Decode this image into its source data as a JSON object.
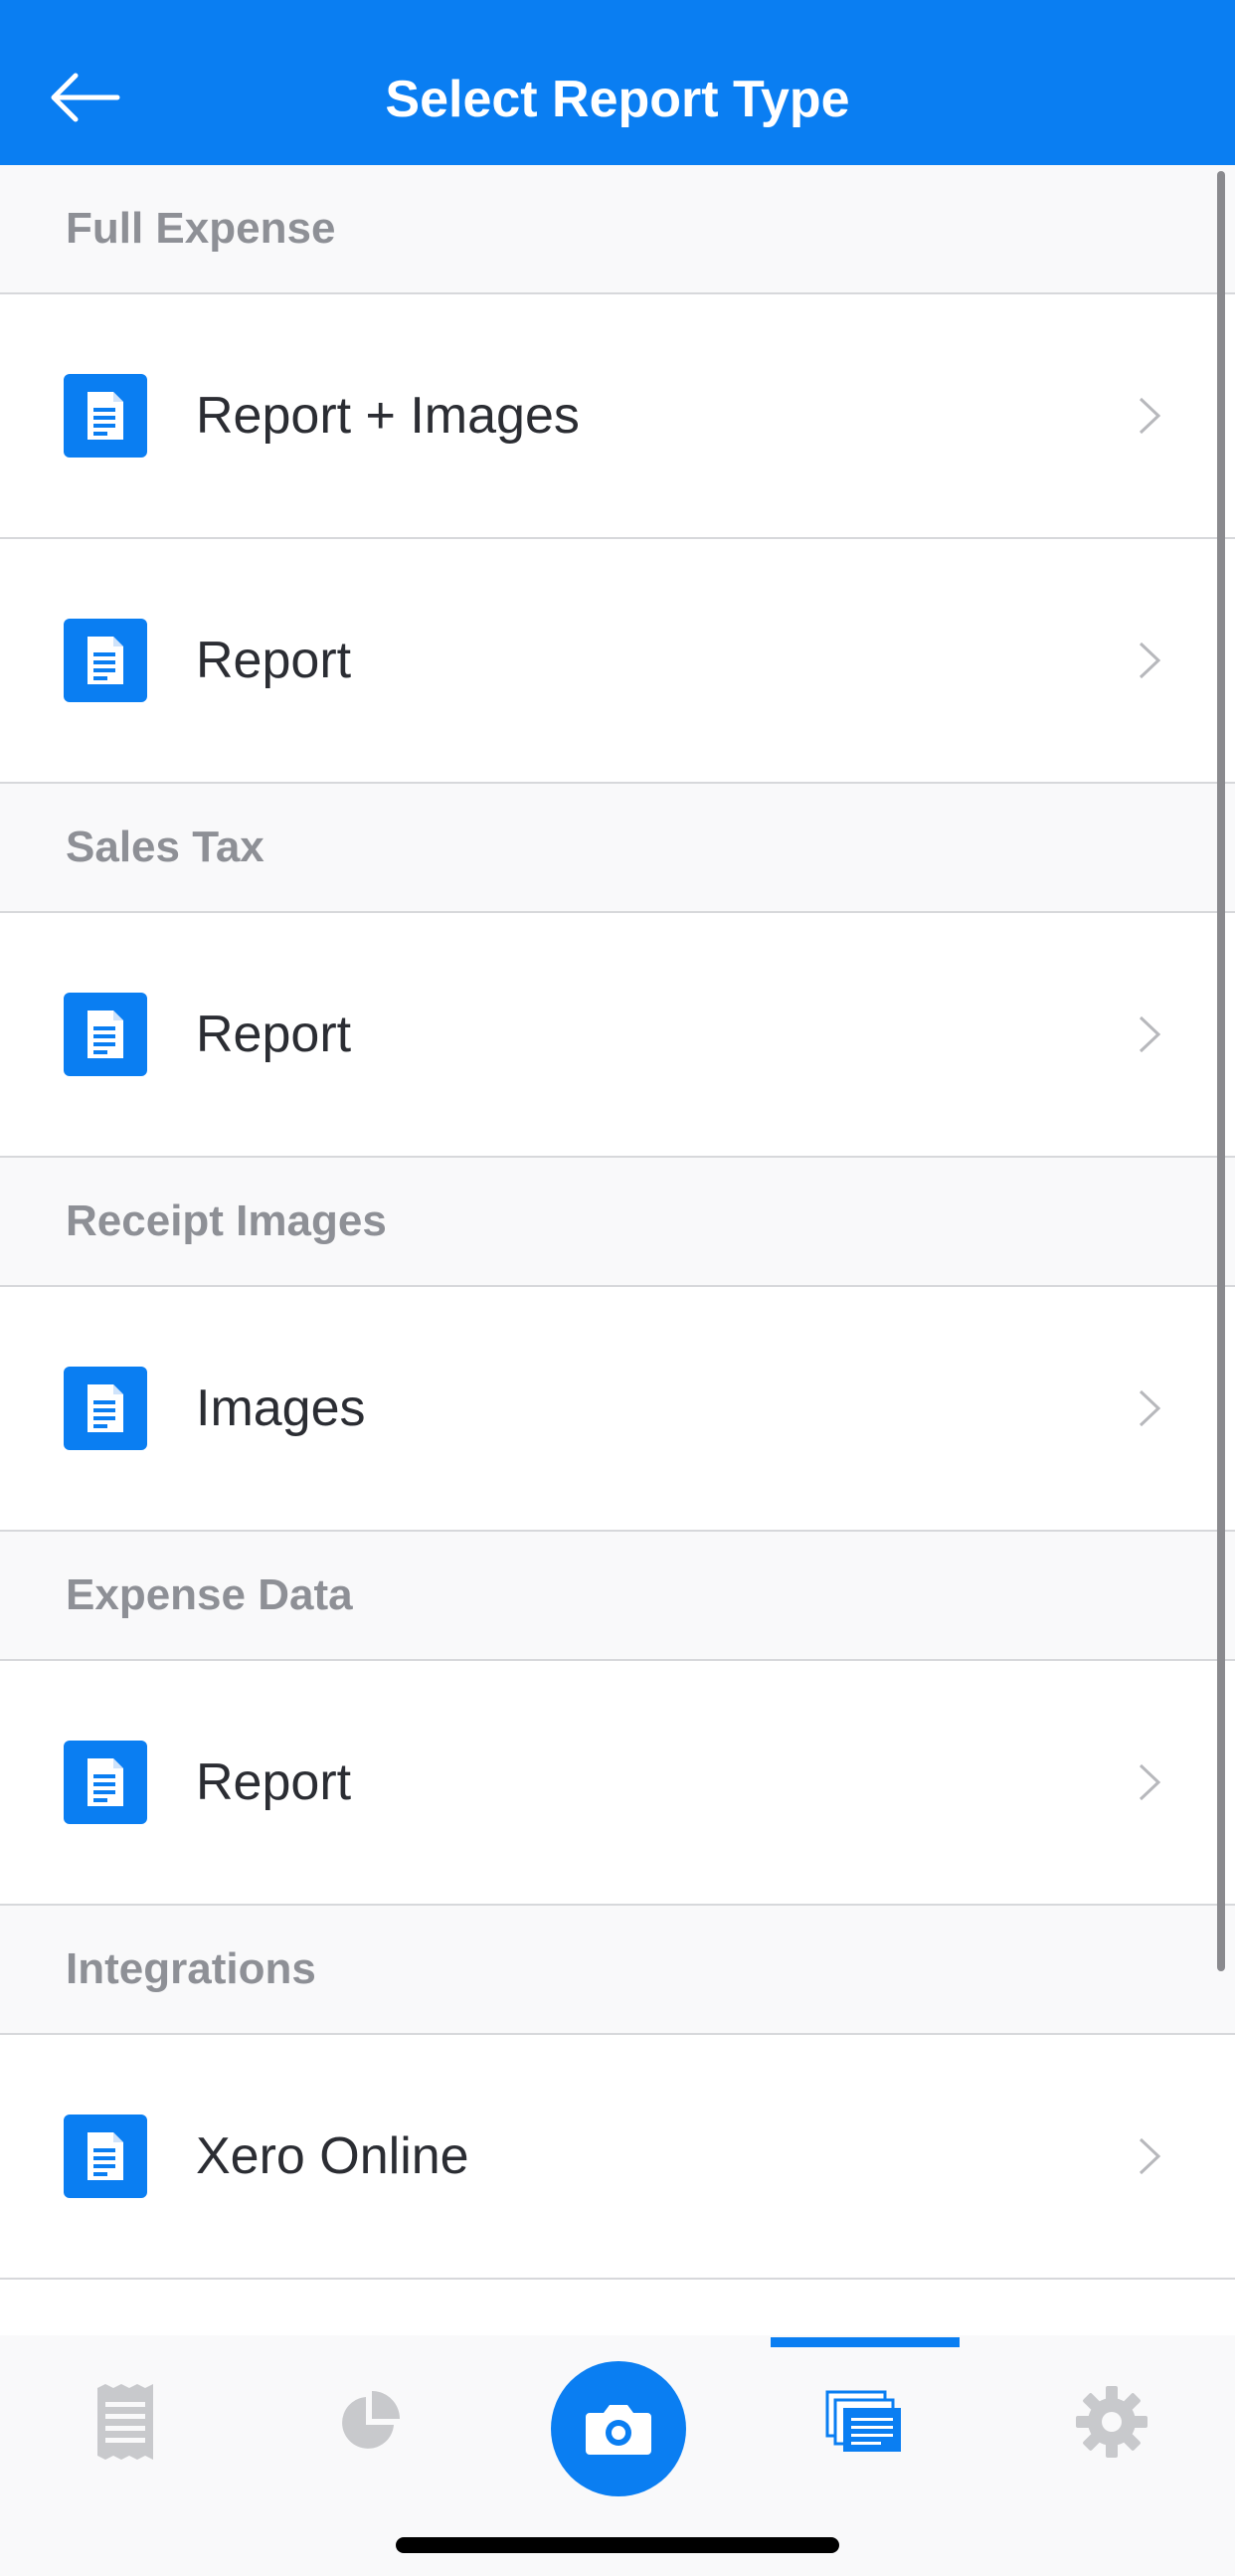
{
  "header": {
    "title": "Select Report Type",
    "back_icon": "arrow-left-icon",
    "color": "#0a7ef2"
  },
  "sections": [
    {
      "title": "Full Expense",
      "items": [
        {
          "label": "Report + Images",
          "icon": "document-icon"
        },
        {
          "label": "Report",
          "icon": "document-icon"
        }
      ]
    },
    {
      "title": "Sales Tax",
      "items": [
        {
          "label": "Report",
          "icon": "document-icon"
        }
      ]
    },
    {
      "title": "Receipt Images",
      "items": [
        {
          "label": "Images",
          "icon": "document-icon"
        }
      ]
    },
    {
      "title": "Expense Data",
      "items": [
        {
          "label": "Report",
          "icon": "document-icon"
        }
      ]
    },
    {
      "title": "Integrations",
      "items": [
        {
          "label": "Xero Online",
          "icon": "document-icon"
        }
      ]
    }
  ],
  "tabbar": {
    "tabs": [
      {
        "name": "receipts",
        "icon": "receipt-icon",
        "active": false
      },
      {
        "name": "charts",
        "icon": "pie-chart-icon",
        "active": false
      },
      {
        "name": "camera",
        "icon": "camera-icon",
        "active": false
      },
      {
        "name": "reports",
        "icon": "reports-stack-icon",
        "active": true
      },
      {
        "name": "settings",
        "icon": "gear-icon",
        "active": false
      }
    ],
    "accent": "#0a7ef2",
    "inactive_color": "#c8c9cc"
  }
}
